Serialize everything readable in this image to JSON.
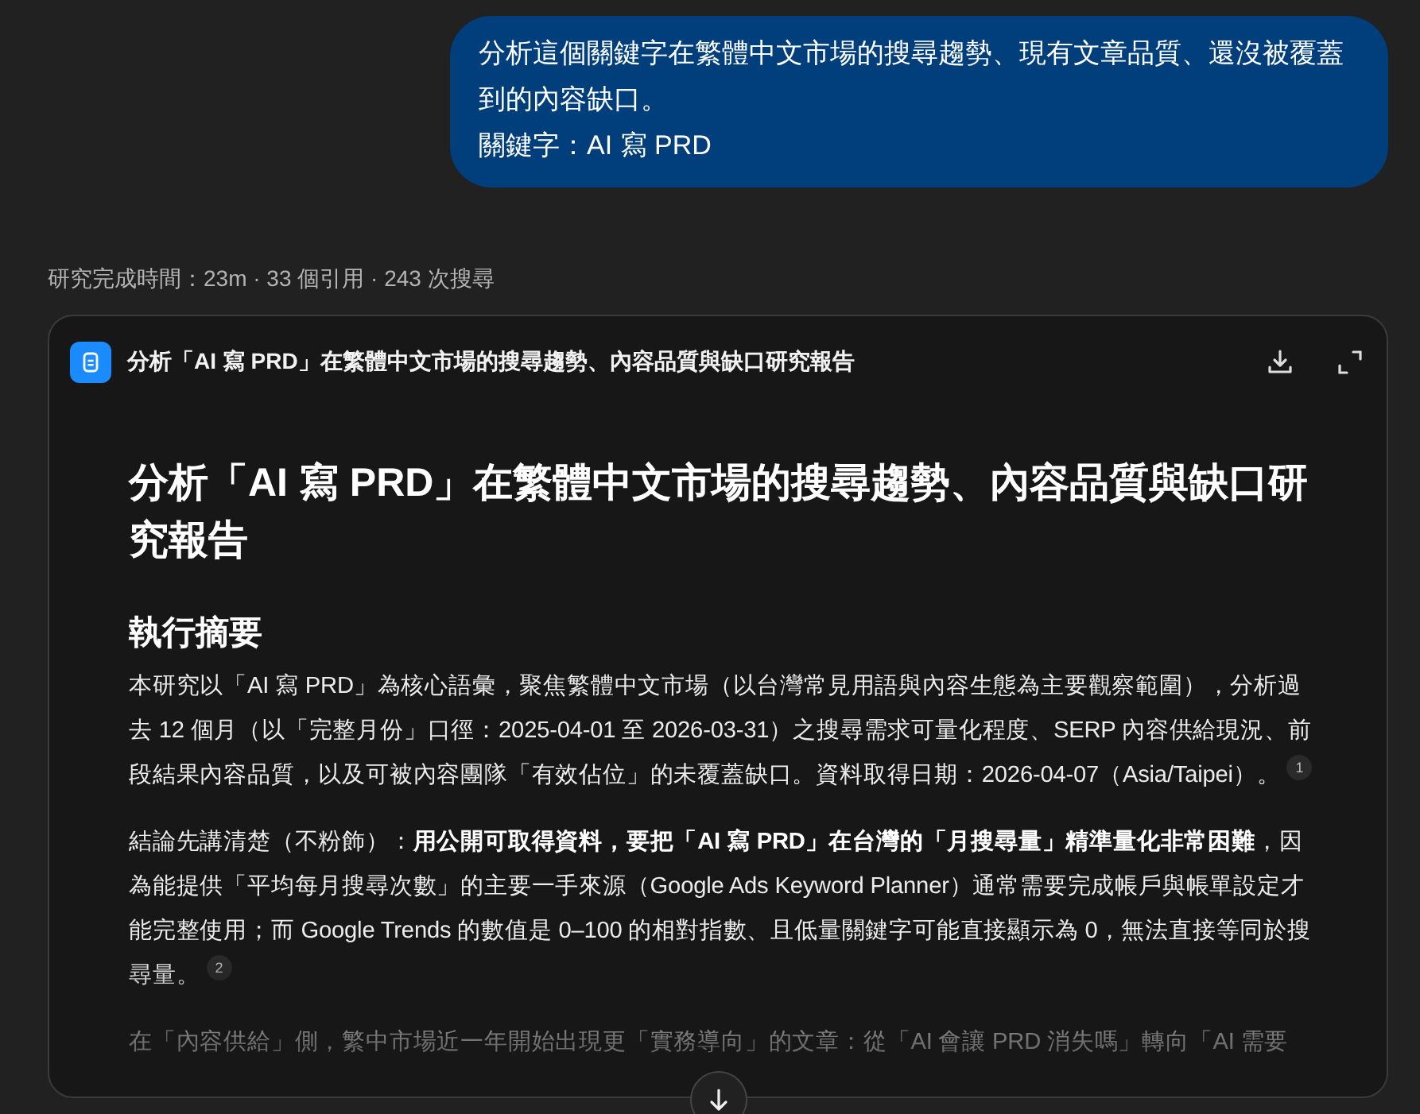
{
  "user_message": {
    "paragraphs": [
      "分析這個關鍵字在繁體中文市場的搜尋趨勢、現有文章品質、還沒被覆蓋到的內容缺口。",
      "關鍵字：AI 寫 PRD"
    ]
  },
  "research_meta": "研究完成時間：23m · 33 個引用 · 243 次搜尋",
  "report_card": {
    "title": "分析「AI 寫 PRD」在繁體中文市場的搜尋趨勢、內容品質與缺口研究報告",
    "document": {
      "heading": "分析「AI 寫 PRD」在繁體中文市場的搜尋趨勢、內容品質與缺口研究報告",
      "section_heading": "執行摘要",
      "paragraphs": [
        {
          "text": "本研究以「AI 寫 PRD」為核心語彙，聚焦繁體中文市場（以台灣常見用語與內容生態為主要觀察範圍），分析過去 12 個月（以「完整月份」口徑：2025-04-01 至 2026-03-31）之搜尋需求可量化程度、SERP 內容供給現況、前段結果內容品質，以及可被內容團隊「有效佔位」的未覆蓋缺口。資料取得日期：2026-04-07（Asia/Taipei）。",
          "footnote": "1"
        },
        {
          "text": "結論先講清楚（不粉飾）：**用公開可取得資料，要把「AI 寫 PRD」在台灣的「月搜尋量」精準量化非常困難**，因為能提供「平均每月搜尋次數」的主要一手來源（Google Ads Keyword Planner）通常需要完成帳戶與帳單設定才能完整使用；而 Google Trends 的數值是 0–100 的相對指數、且低量關鍵字可能直接顯示為 0，無法直接等同於搜尋量。",
          "footnote": "2"
        },
        {
          "text": "在「內容供給」側，繁中市場近一年開始出現更「實務導向」的文章：從「AI 會讓 PRD 消失嗎」轉向「AI 需要"
        }
      ]
    }
  }
}
